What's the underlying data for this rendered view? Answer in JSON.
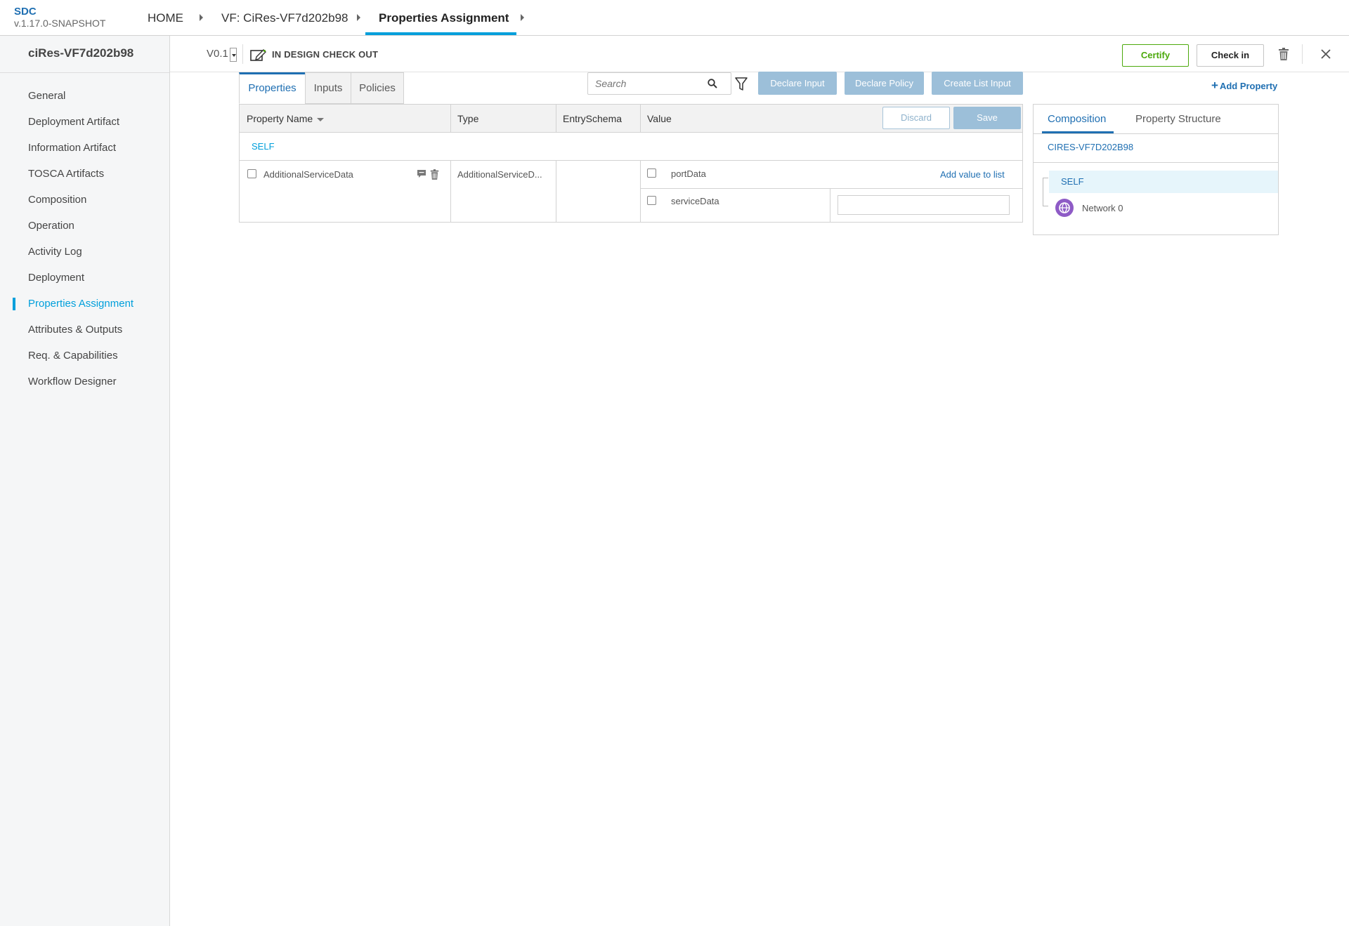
{
  "brand": {
    "name": "SDC",
    "version": "v.1.17.0-SNAPSHOT"
  },
  "breadcrumb": {
    "home": "HOME",
    "vf": "VF: CiRes-VF7d202b98",
    "current": "Properties Assignment"
  },
  "sidebar": {
    "title": "ciRes-VF7d202b98",
    "items": [
      {
        "label": "General"
      },
      {
        "label": "Deployment Artifact"
      },
      {
        "label": "Information Artifact"
      },
      {
        "label": "TOSCA Artifacts"
      },
      {
        "label": "Composition"
      },
      {
        "label": "Operation"
      },
      {
        "label": "Activity Log"
      },
      {
        "label": "Deployment"
      },
      {
        "label": "Properties Assignment"
      },
      {
        "label": "Attributes & Outputs"
      },
      {
        "label": "Req. & Capabilities"
      },
      {
        "label": "Workflow Designer"
      }
    ],
    "active_item": "Properties Assignment"
  },
  "subheader": {
    "version": "V0.1",
    "status": "IN DESIGN CHECK OUT",
    "certify_label": "Certify",
    "checkin_label": "Check in"
  },
  "tabs": {
    "properties": "Properties",
    "inputs": "Inputs",
    "policies": "Policies"
  },
  "search": {
    "placeholder": "Search"
  },
  "actions": {
    "declare_input": "Declare Input",
    "declare_policy": "Declare Policy",
    "create_list_input": "Create List Input",
    "add_property": "Add Property"
  },
  "table": {
    "columns": {
      "property_name": "Property Name",
      "type": "Type",
      "entry_schema": "EntrySchema",
      "value": "Value"
    },
    "discard_label": "Discard",
    "save_label": "Save",
    "group_label": "SELF",
    "row": {
      "name": "AdditionalServiceData",
      "type": "AdditionalServiceD...",
      "entry_schema": "",
      "sub_properties": [
        {
          "name": "portData",
          "action": "Add value to list"
        },
        {
          "name": "serviceData",
          "value": ""
        }
      ]
    }
  },
  "right_panel": {
    "tabs": {
      "composition": "Composition",
      "property_structure": "Property Structure"
    },
    "component_name": "CIRES-VF7D202B98",
    "tree": {
      "self_label": "SELF",
      "instance_label": "Network 0"
    }
  },
  "colors": {
    "accent": "#009fdb",
    "link": "#1f6fb2",
    "certify": "#4ca90c",
    "disabled_button": "#9cbfd9",
    "network_icon": "#8e5bc6"
  },
  "icons": [
    "checkout-icon",
    "search-icon",
    "filter-icon",
    "comment-icon",
    "trash-icon",
    "close-icon",
    "plus-icon",
    "network-icon"
  ]
}
